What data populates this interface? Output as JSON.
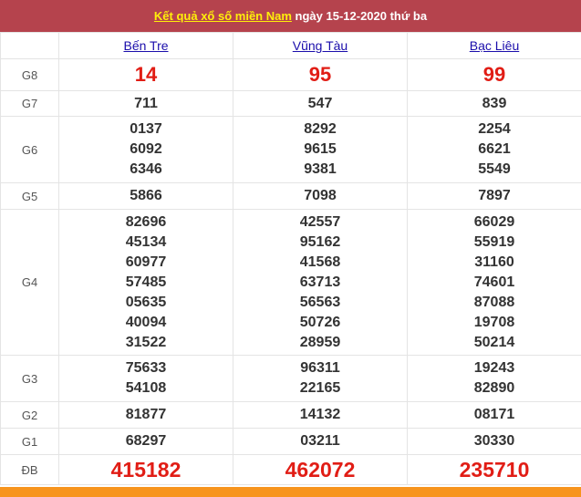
{
  "header": {
    "title_link": "Kết quả xổ số miền Nam",
    "date_text": "ngày 15-12-2020 thứ ba"
  },
  "provinces": [
    "Bến Tre",
    "Vũng Tàu",
    "Bạc Liêu"
  ],
  "prizes": {
    "G8": {
      "label": "G8",
      "values": [
        "14",
        "95",
        "99"
      ]
    },
    "G7": {
      "label": "G7",
      "values": [
        "711",
        "547",
        "839"
      ]
    },
    "G6": {
      "label": "G6",
      "values": [
        [
          "0137",
          "6092",
          "6346"
        ],
        [
          "8292",
          "9615",
          "9381"
        ],
        [
          "2254",
          "6621",
          "5549"
        ]
      ]
    },
    "G5": {
      "label": "G5",
      "values": [
        "5866",
        "7098",
        "7897"
      ]
    },
    "G4": {
      "label": "G4",
      "values": [
        [
          "82696",
          "45134",
          "60977",
          "57485",
          "05635",
          "40094",
          "31522"
        ],
        [
          "42557",
          "95162",
          "41568",
          "63713",
          "56563",
          "50726",
          "28959"
        ],
        [
          "66029",
          "55919",
          "31160",
          "74601",
          "87088",
          "19708",
          "50214"
        ]
      ]
    },
    "G3": {
      "label": "G3",
      "values": [
        [
          "75633",
          "54108"
        ],
        [
          "96311",
          "22165"
        ],
        [
          "19243",
          "82890"
        ]
      ]
    },
    "G2": {
      "label": "G2",
      "values": [
        "81877",
        "14132",
        "08171"
      ]
    },
    "G1": {
      "label": "G1",
      "values": [
        "68297",
        "03211",
        "30330"
      ]
    },
    "DB": {
      "label": "ĐB",
      "values": [
        "415182",
        "462072",
        "235710"
      ]
    }
  },
  "colors": {
    "header_bg": "#b5434d",
    "title_link": "#ffef0a",
    "highlight_red": "#e11d15",
    "province_link": "#1a0dab",
    "footer_bar": "#f7941d"
  }
}
